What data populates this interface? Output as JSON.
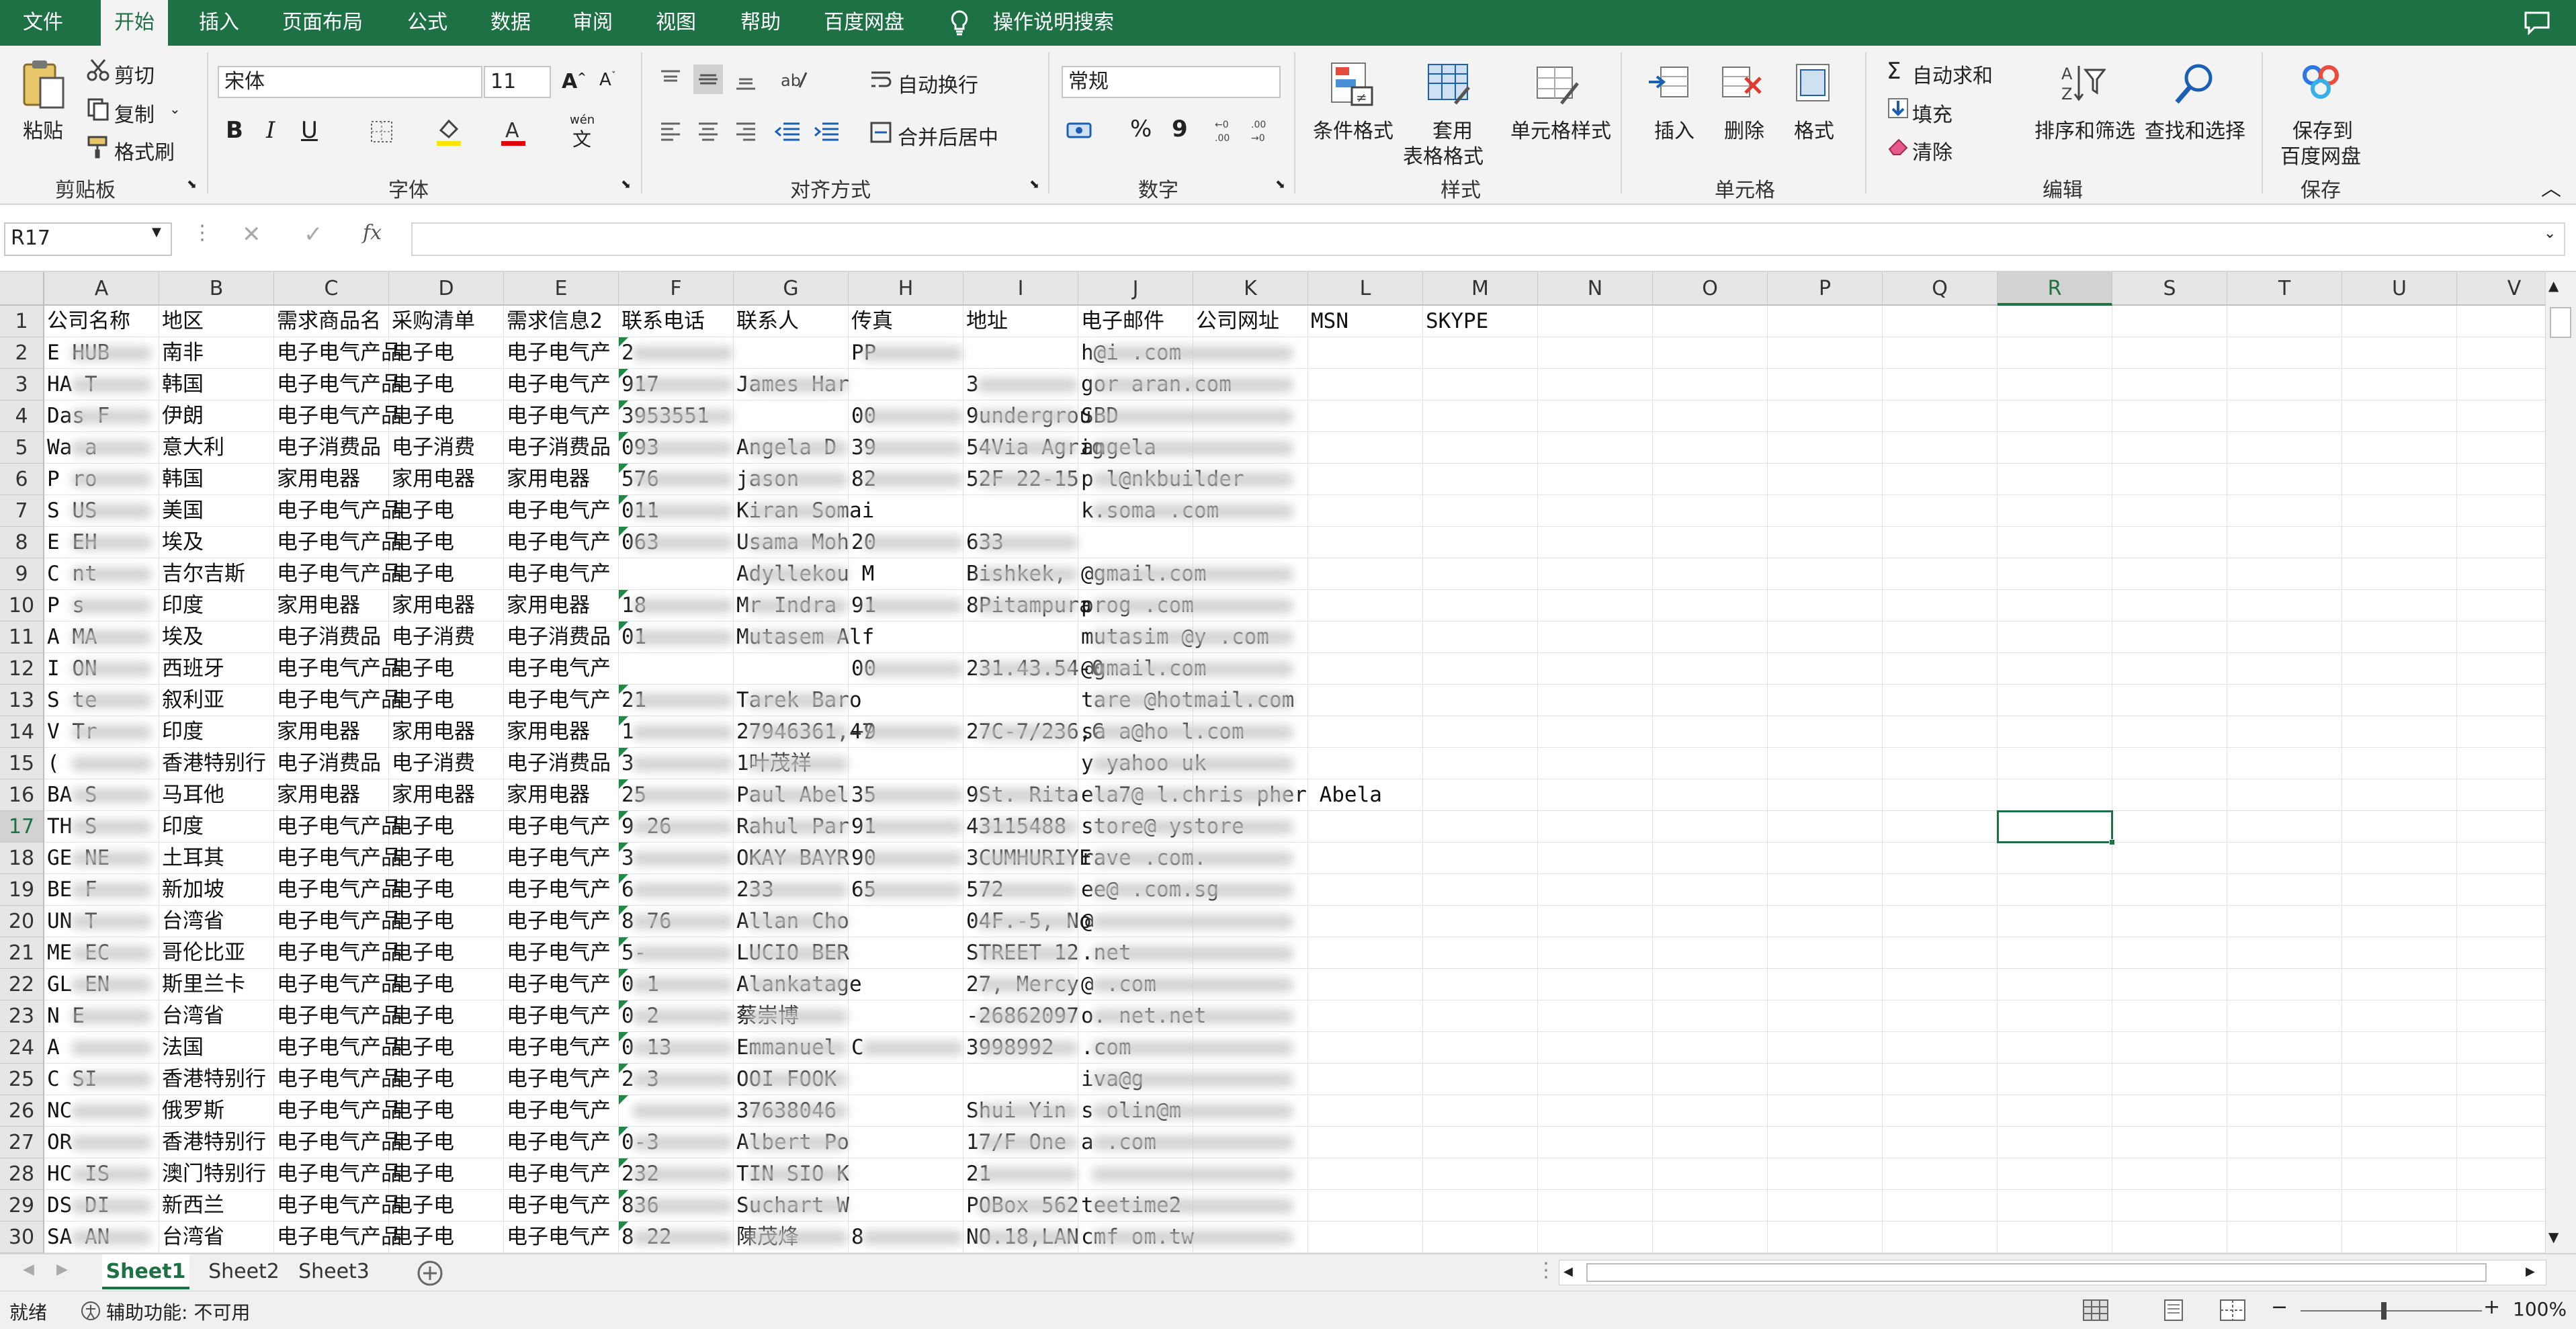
{
  "menu": [
    "文件",
    "开始",
    "插入",
    "页面布局",
    "公式",
    "数据",
    "审阅",
    "视图",
    "帮助",
    "百度网盘"
  ],
  "menu_search": "操作说明搜索",
  "ribbon": {
    "clipboard": {
      "paste": "粘贴",
      "cut": "剪切",
      "copy": "复制",
      "painter": "格式刷",
      "name": "剪贴板"
    },
    "font": {
      "family": "宋体",
      "size": "11",
      "bold": "B",
      "italic": "I",
      "underline": "U",
      "phonetic": "wén",
      "name": "字体"
    },
    "align": {
      "wrap": "自动换行",
      "merge": "合并后居中",
      "name": "对齐方式"
    },
    "number": {
      "format": "常规",
      "percent": "%",
      "comma": "9",
      "name": "数字"
    },
    "styles": {
      "conditional": "条件格式",
      "table1": "套用",
      "table2": "表格格式",
      "cell": "单元格样式",
      "name": "样式"
    },
    "cells": {
      "insert": "插入",
      "delete": "删除",
      "format": "格式",
      "name": "单元格"
    },
    "editing": {
      "autosum": "自动求和",
      "fill": "填充",
      "clear": "清除",
      "sort": "排序和筛选",
      "find": "查找和选择",
      "name": "编辑"
    },
    "save": {
      "l1": "保存到",
      "l2": "百度网盘",
      "name": "保存"
    }
  },
  "formula": {
    "namebox": "R17",
    "fx": "fx",
    "value": ""
  },
  "columns": [
    "A",
    "B",
    "C",
    "D",
    "E",
    "F",
    "G",
    "H",
    "I",
    "J",
    "K",
    "L",
    "M",
    "N",
    "O",
    "P",
    "Q",
    "R",
    "S",
    "T",
    "U",
    "V"
  ],
  "selected_col": "R",
  "selected_row": 17,
  "rows": [
    {
      "n": 1,
      "c": {
        "A": "公司名称",
        "B": "地区",
        "C": "需求商品名",
        "D": "采购清单",
        "E": "需求信息2",
        "F": "联系电话",
        "G": "联系人",
        "H": "传真",
        "I": "地址",
        "J": "电子邮件",
        "K": "公司网址",
        "L": "MSN",
        "M": "SKYPE"
      }
    },
    {
      "n": 2,
      "c": {
        "A": "E  HUB",
        "B": "南非",
        "C": "电子电气产品",
        "D": "电子电",
        "E": "电子电气产",
        "F": "2",
        "H": "PP",
        "J": "h@i  .com"
      }
    },
    {
      "n": 3,
      "c": {
        "A": "HA    T",
        "B": "韩国",
        "C": "电子电气产品",
        "D": "电子电",
        "E": "电子电气产",
        "F": "    917",
        "G": "James Har",
        "I": "3",
        "J": "gor  aran.com"
      }
    },
    {
      "n": 4,
      "c": {
        "A": "Das    F",
        "B": "伊朗",
        "C": "电子电气产品",
        "D": "电子电",
        "E": "电子电气产",
        "F": "   3953551",
        "H": "00",
        "I": "9undergrou",
        "J": "SBD"
      }
    },
    {
      "n": 5,
      "c": {
        "A": "Wa   a",
        "B": "意大利",
        "C": "电子消费品",
        "D": "电子消费",
        "E": "电子消费品",
        "F": "   093",
        "G": "Angela D",
        "H": "39",
        "I": "54Via Agrig",
        "J": "angela"
      }
    },
    {
      "n": 6,
      "c": {
        "A": "P  ro",
        "B": "韩国",
        "C": "家用电器",
        "D": "家用电器",
        "E": "家用电器",
        "F": "    576",
        "G": "jason",
        "H": "82",
        "I": "52F 22-15",
        "J": "p    l@nkbuilder"
      }
    },
    {
      "n": 7,
      "c": {
        "A": "S    US",
        "B": "美国",
        "C": "电子电气产品",
        "D": "电子电",
        "E": "电子电气产",
        "F": "   011",
        "G": "Kiran Somai",
        "J": "k.soma    .com"
      }
    },
    {
      "n": 8,
      "c": {
        "A": "E    EH",
        "B": "埃及",
        "C": "电子电气产品",
        "D": "电子电",
        "E": "电子电气产",
        "F": "   063",
        "G": "Usama Moh",
        "H": "20",
        "I": "633"
      }
    },
    {
      "n": 9,
      "c": {
        "A": "C   nt",
        "B": "吉尔吉斯",
        "C": "电子电气产品",
        "D": "电子电",
        "E": "电子电气产",
        "G": "Adyllekou M",
        "I": "Bishkek,",
        "J": "     @gmail.com"
      }
    },
    {
      "n": 10,
      "c": {
        "A": "P    s",
        "B": "印度",
        "C": "家用电器",
        "D": "家用电器",
        "E": "家用电器",
        "F": "   18",
        "G": "Mr Indra",
        "H": "91",
        "I": "8Pitampura",
        "J": "prog   .com"
      }
    },
    {
      "n": 11,
      "c": {
        "A": "A    MA",
        "B": "埃及",
        "C": "电子消费品",
        "D": "电子消费",
        "E": "电子消费品",
        "F": "   01",
        "G": "Mutasem Alf",
        "J": "mutasim  @y  .com"
      }
    },
    {
      "n": 12,
      "c": {
        "A": "I    ON",
        "B": "西班牙",
        "C": "电子电气产品",
        "D": "电子电",
        "E": "电子电气产",
        "H": "00",
        "I": "231.43.54-0",
        "J": "   @gmail.com"
      }
    },
    {
      "n": 13,
      "c": {
        "A": "S    te",
        "B": "叙利亚",
        "C": "电子电气产品",
        "D": "电子电",
        "E": "电子电气产",
        "F": "   21",
        "G": "Tarek  Baro",
        "J": "tare   @hotmail.com"
      }
    },
    {
      "n": 14,
      "c": {
        "A": "V    Tr",
        "B": "印度",
        "C": "家用电器",
        "D": "家用电器",
        "E": "家用电器",
        "F": "   1",
        "G": "27946361,47",
        "H": "+9",
        "I": "27C-7/236,C",
        "J": "sa   a@ho  l.com"
      }
    },
    {
      "n": 15,
      "c": {
        "A": "   (",
        "B": "香港特别行",
        "C": "电子消费品",
        "D": "电子消费",
        "E": "电子消费品",
        "F": "  3",
        "G": "1叶茂祥",
        "J": "   y  yahoo   uk"
      }
    },
    {
      "n": 16,
      "c": {
        "A": "BA    S",
        "B": "马耳他",
        "C": "家用电器",
        "D": "家用电器",
        "E": "家用电器",
        "F": "   25",
        "G": "Paul Abel",
        "H": "35",
        "I": "9St. Rita",
        "J": "    ela7@   l.chris  pher Abela"
      }
    },
    {
      "n": 17,
      "c": {
        "A": "TH    S",
        "B": "印度",
        "C": "电子电气产品",
        "D": "电子电",
        "E": "电子电气产",
        "F": "9   26",
        "G": "Rahul Par",
        "H": "91",
        "I": "43115488",
        "J": "   store@  ystore"
      }
    },
    {
      "n": 18,
      "c": {
        "A": "GE    NE",
        "B": "土耳其",
        "C": "电子电气产品",
        "D": "电子电",
        "E": "电子电气产",
        "F": "   3",
        "G": "OKAY BAYR",
        "H": "90",
        "I": "3CUMHURIYE",
        "J": "   rave    .com."
      }
    },
    {
      "n": 19,
      "c": {
        "A": "BE    F",
        "B": "新加坡",
        "C": "电子电气产品",
        "D": "电子电",
        "E": "电子电气产",
        "F": "6",
        "G": "233",
        "H": "65",
        "I": "572",
        "J": "   ee@   .com.sg"
      }
    },
    {
      "n": 20,
      "c": {
        "A": "UN    T",
        "B": "台湾省",
        "C": "电子电气产品",
        "D": "电子电",
        "E": "电子电气产",
        "F": "8   76",
        "G": "Allan Cho",
        "I": "04F.-5, No",
        "J": "   @   "
      }
    },
    {
      "n": 21,
      "c": {
        "A": "ME    EC",
        "B": "哥伦比亚",
        "C": "电子电气产品",
        "D": "电子电",
        "E": "电子电气产",
        "F": "   5-",
        "G": "LUCIO BER",
        "I": "STREET 12",
        "J": "   .net"
      }
    },
    {
      "n": 22,
      "c": {
        "A": "GL    EN",
        "B": "斯里兰卡",
        "C": "电子电气产品",
        "D": "电子电",
        "E": "电子电气产",
        "F": "0  1",
        "G": "Alankatage",
        "I": "27, Mercy",
        "J": "   @   .com"
      }
    },
    {
      "n": 23,
      "c": {
        "A": "N    E",
        "B": "台湾省",
        "C": "电子电气产品",
        "D": "电子电",
        "E": "电子电气产",
        "F": "0  2",
        "G": "蔡崇博",
        "I": "-26862097",
        "J": "   o.  net.net"
      }
    },
    {
      "n": 24,
      "c": {
        "A": "A",
        "B": "法国",
        "C": "电子电气产品",
        "D": "电子电",
        "E": "电子电气产",
        "F": "0   13",
        "G": "Emmanuel",
        "H": "C",
        "I": "3998992",
        "J": "   .com"
      }
    },
    {
      "n": 25,
      "c": {
        "A": "C    SI",
        "B": "香港特别行",
        "C": "电子电气产品",
        "D": "电子电",
        "E": "电子电气产",
        "F": "2   3",
        "G": "OOI FOOK",
        "J": "   iva@g"
      }
    },
    {
      "n": 26,
      "c": {
        "A": "    NC",
        "B": "俄罗斯",
        "C": "电子电气产品",
        "D": "电子电",
        "E": "电子电气产",
        "F": "   ",
        "G": "37638046",
        "I": "Shui Yin",
        "J": "s  olin@m"
      }
    },
    {
      "n": 27,
      "c": {
        "A": "    OR",
        "B": "香港特别行",
        "C": "电子电气产品",
        "D": "电子电",
        "E": "电子电气产",
        "F": "   0-3",
        "G": "Albert Po",
        "I": "17/F One",
        "J": "a   .com"
      }
    },
    {
      "n": 28,
      "c": {
        "A": "HC    IS",
        "B": "澳门特别行",
        "C": "电子电气产品",
        "D": "电子电",
        "E": "电子电气产",
        "F": "   232",
        "G": "TIN SIO K",
        "I": "21",
        "J": "   "
      }
    },
    {
      "n": 29,
      "c": {
        "A": "DS    DI",
        "B": "新西兰",
        "C": "电子电气产品",
        "D": "电子电",
        "E": "电子电气产",
        "F": "   836",
        "G": "Suchart W",
        "I": "POBox 562",
        "J": "teetime2"
      }
    },
    {
      "n": 30,
      "c": {
        "A": "SA    AN",
        "B": "台湾省",
        "C": "电子电气产品",
        "D": "电子电",
        "E": "电子电气产",
        "F": "8   22",
        "G": "陳茂烽",
        "H": "8",
        "I": "NO.18,LAN",
        "J": "cmf   om.tw"
      }
    }
  ],
  "sheets": [
    "Sheet1",
    "Sheet2",
    "Sheet3"
  ],
  "active_sheet": "Sheet1",
  "status": {
    "ready": "就绪",
    "accessibility": "辅助功能: 不可用",
    "zoom": "100%"
  },
  "colors": {
    "accent": "#1e7145",
    "selection": "#1e7145"
  }
}
